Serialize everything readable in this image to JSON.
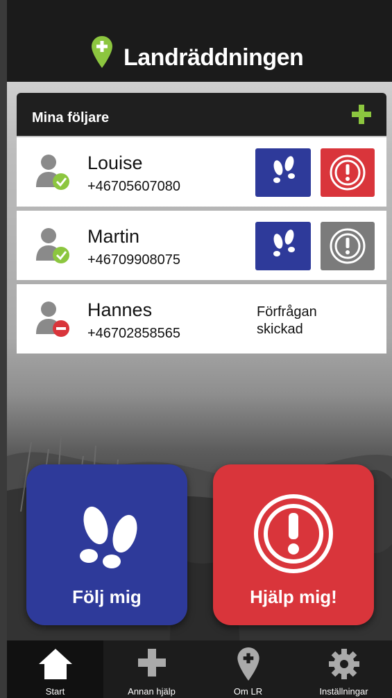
{
  "app": {
    "brand": "Landräddningen"
  },
  "followers": {
    "title": "Mina följare",
    "items": [
      {
        "name": "Louise",
        "phone": "+46705607080",
        "status": "accepted",
        "help_state": "active"
      },
      {
        "name": "Martin",
        "phone": "+46709908075",
        "status": "accepted",
        "help_state": "inactive"
      },
      {
        "name": "Hannes",
        "phone": "+46702858565",
        "status": "pending",
        "pending_text_1": "Förfrågan",
        "pending_text_2": "skickad"
      }
    ]
  },
  "actions": {
    "follow_label": "Följ mig",
    "help_label": "Hjälp mig!"
  },
  "tabs": [
    {
      "label": "Start",
      "icon": "home-icon",
      "active": true
    },
    {
      "label": "Annan hjälp",
      "icon": "plus-icon"
    },
    {
      "label": "Om LR",
      "icon": "location-pin-icon"
    },
    {
      "label": "Inställningar",
      "icon": "gear-icon"
    }
  ],
  "colors": {
    "blue": "#2e3a9a",
    "red": "#d9353b",
    "grey": "#7b7b7b",
    "green": "#8cc63f"
  }
}
